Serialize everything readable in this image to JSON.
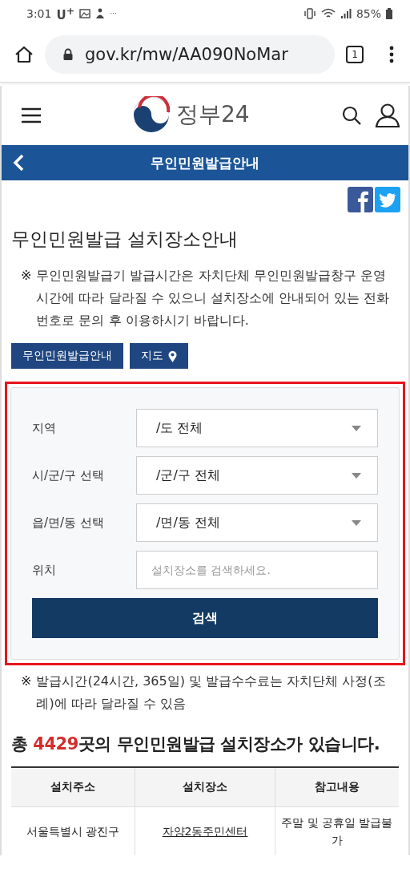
{
  "status_bar": {
    "time": "3:01",
    "carrier": "U$^{+}$",
    "notification_more": "···",
    "battery": "85%"
  },
  "browser": {
    "url": "gov.kr/mw/AA090NoMar",
    "tab_count": "1"
  },
  "site_header": {
    "logo_text": "정부24"
  },
  "title_bar": {
    "title": "무인민원발급안내"
  },
  "page_title": "무인민원발급 설치장소안내",
  "notice": {
    "mark": "※",
    "text": "무인민원발급기 발급시간은 자치단체 무인민원발급창구 운영시간에 따라 달라질 수 있으니 설치장소에 안내되어 있는 전화번호로 문의 후 이용하시기 바랍니다."
  },
  "buttons": [
    {
      "label": "무인민원발급안내",
      "kind": "plain"
    },
    {
      "label": "지도",
      "kind": "map"
    }
  ],
  "search_form": {
    "highlighted": true,
    "fields": [
      {
        "label": "지역",
        "kind": "select",
        "value": "/도 전체"
      },
      {
        "label": "시/군/구 선택",
        "kind": "select",
        "value": "/군/구 전체"
      },
      {
        "label": "읍/면/동 선택",
        "kind": "select",
        "value": "/면/동 전체"
      },
      {
        "label": "위치",
        "kind": "text",
        "placeholder": "설치장소를 검색하세요."
      }
    ],
    "submit": "검색"
  },
  "fee_notice": {
    "mark": "※",
    "text": "발급시간(24시간, 365일) 및 발급수수료는 자치단체 사정(조례)에 따라 달라질 수 있음"
  },
  "total": {
    "prefix": "총 ",
    "count": "4429",
    "suffix": "곳의 무인민원발급 설치장소가 있습니다."
  },
  "table": {
    "columns": [
      "설치주소",
      "설치장소",
      "참고내용"
    ],
    "rows": [
      {
        "address": "서울특별시 광진구",
        "place": "자양2동주민센터",
        "note": "주말 및 공휴일 발급불가"
      }
    ]
  }
}
